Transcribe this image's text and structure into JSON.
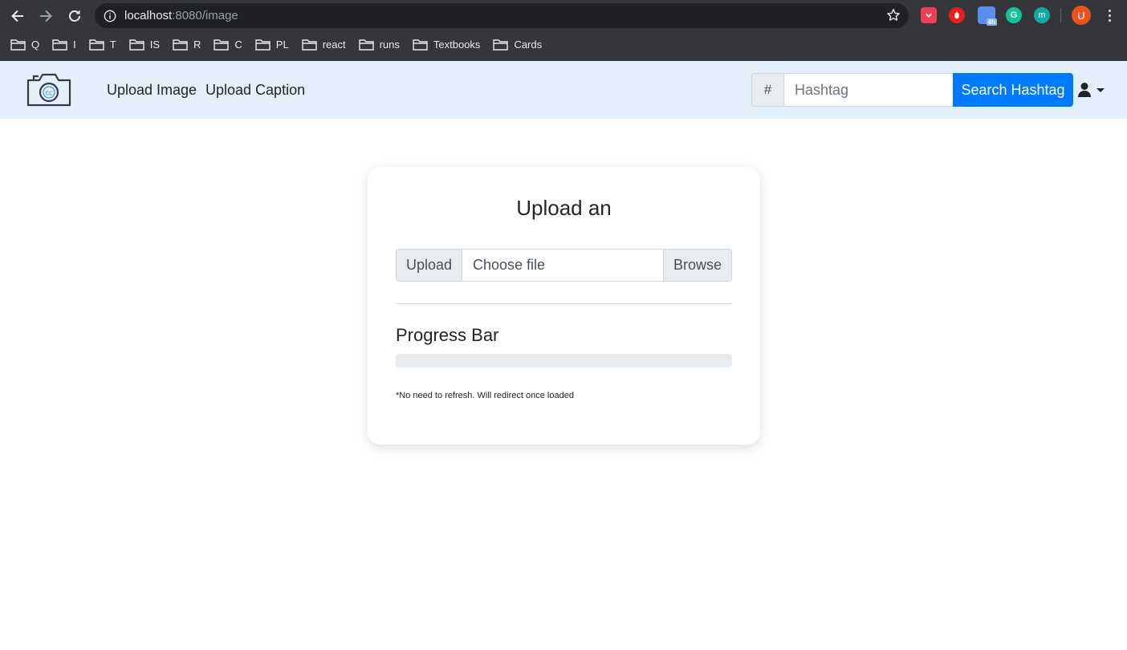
{
  "browser": {
    "url_host": "localhost",
    "url_rest": ":8080/image",
    "bookmarks": [
      "Q",
      "I",
      "T",
      "IS",
      "R",
      "C",
      "PL",
      "react",
      "runs",
      "Textbooks",
      "Cards"
    ],
    "profile_initial": "U",
    "extensions": [
      {
        "name": "pocket-extension-icon",
        "color": "#ef3f56"
      },
      {
        "name": "adblock-extension-icon",
        "color": "#e2211c"
      },
      {
        "name": "window-extension-icon",
        "color": "#5b8def",
        "badge": "4h"
      },
      {
        "name": "grammarly-extension-icon",
        "color": "#15c39a",
        "letter": "G"
      },
      {
        "name": "mercury-extension-icon",
        "color": "#16a9a1",
        "letter": "m"
      }
    ]
  },
  "navbar": {
    "links": [
      "Upload Image",
      "Upload Caption"
    ],
    "hashtag_prefix": "#",
    "hashtag_placeholder": "Hashtag",
    "search_label": "Search Hashtag"
  },
  "card": {
    "title": "Upload an",
    "upload_label": "Upload",
    "file_label": "Choose file",
    "browse_label": "Browse",
    "progress_heading": "Progress Bar",
    "progress_fraction": 0,
    "note": "*No need to refresh. Will redirect once loaded"
  },
  "colors": {
    "navbar_bg": "#e3f0fb",
    "primary": "#007bff",
    "chrome_bg": "#35363a"
  }
}
